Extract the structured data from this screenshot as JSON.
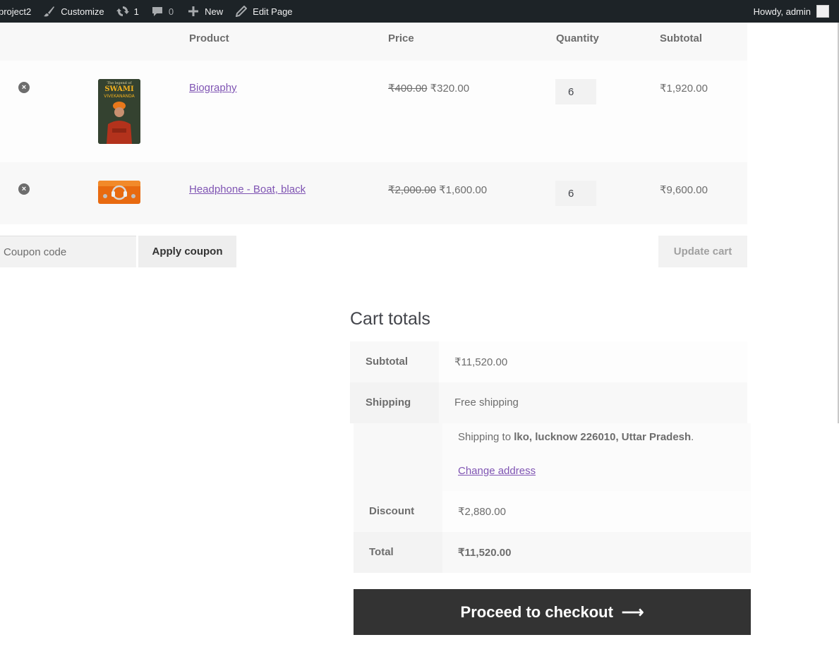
{
  "adminbar": {
    "site_name": "project2",
    "customize": "Customize",
    "updates_count": "1",
    "comments_count": "0",
    "new_label": "New",
    "edit_page": "Edit Page",
    "howdy": "Howdy, admin"
  },
  "cart": {
    "headers": {
      "product": "Product",
      "price": "Price",
      "quantity": "Quantity",
      "subtotal": "Subtotal"
    },
    "items": [
      {
        "name": "Biography",
        "regular_price": "₹400.00",
        "sale_price": "₹320.00",
        "quantity": "6",
        "subtotal": "₹1,920.00",
        "thumb_text": {
          "top": "The legend of",
          "title": "SWAMI",
          "subtitle": "VIVEKANANDA"
        }
      },
      {
        "name": "Headphone - Boat, black",
        "regular_price": "₹2,000.00",
        "sale_price": "₹1,600.00",
        "quantity": "6",
        "subtotal": "₹9,600.00"
      }
    ],
    "coupon_placeholder": "Coupon code",
    "apply_coupon": "Apply coupon",
    "update_cart": "Update cart"
  },
  "totals": {
    "title": "Cart totals",
    "subtotal_label": "Subtotal",
    "subtotal_value": "₹11,520.00",
    "shipping_label": "Shipping",
    "shipping_method": "Free shipping",
    "shipping_to_prefix": "Shipping to ",
    "shipping_to_address": "lko, lucknow 226010, Uttar Pradesh",
    "shipping_to_suffix": ".",
    "change_address": "Change address",
    "discount_label": "Discount",
    "discount_value": "₹2,880.00",
    "total_label": "Total",
    "total_value": "₹11,520.00",
    "checkout": "Proceed to checkout",
    "checkout_arrow": "⟶"
  },
  "colors": {
    "link": "#7f54b3",
    "adminbar": "#1d2327",
    "checkout_bg": "#333333"
  }
}
